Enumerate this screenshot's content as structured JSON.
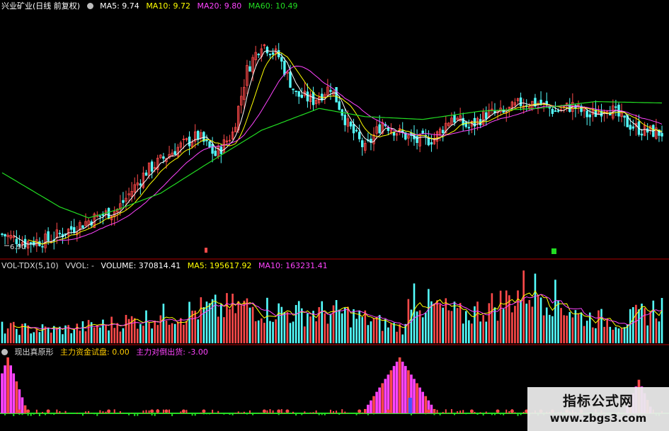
{
  "colors": {
    "up": "#ff4a4a",
    "down": "#54ffff",
    "ma5": "#ffffff",
    "ma10": "#ffff00",
    "ma20": "#ff44ff",
    "ma60": "#22dd22",
    "label": "#ffcc00",
    "sep": "#8b0000"
  },
  "price_panel": {
    "title": "兴业矿业(日线 前复权)",
    "icon": "circle-icon",
    "ma5_label": "MA5: 9.74",
    "ma10_label": "MA10: 9.72",
    "ma20_label": "MA20: 9.80",
    "ma60_label": "MA60: 10.49",
    "low_marker": "6.90"
  },
  "volume_panel": {
    "title": "VOL-TDX(5,10)",
    "vvol": "VVOL: -",
    "volume": "VOLUME: 370814.41",
    "ma5": "MA5: 195617.92",
    "ma10": "MA10: 163231.41"
  },
  "indicator_panel": {
    "title": "现出真原形",
    "icon": "circle-icon",
    "trial": "主力资金试盘: 0.00",
    "dump": "主力对倒出货: -3.00",
    "marker_text": "S"
  },
  "watermark": {
    "title": "指标公式网",
    "url": "www.zbgs3.com"
  },
  "chart_data": [
    {
      "type": "candlestick",
      "title": "兴业矿业(日线 前复权)",
      "ylim": [
        6.5,
        15.5
      ],
      "close_anchors": [
        [
          0,
          7.3
        ],
        [
          8,
          7.0
        ],
        [
          16,
          7.1
        ],
        [
          24,
          7.5
        ],
        [
          32,
          7.9
        ],
        [
          40,
          8.2
        ],
        [
          50,
          9.6
        ],
        [
          60,
          10.4
        ],
        [
          68,
          10.9
        ],
        [
          74,
          10.2
        ],
        [
          80,
          11.0
        ],
        [
          85,
          13.3
        ],
        [
          90,
          14.3
        ],
        [
          96,
          13.8
        ],
        [
          102,
          12.4
        ],
        [
          108,
          12.2
        ],
        [
          114,
          12.7
        ],
        [
          120,
          11.3
        ],
        [
          126,
          10.4
        ],
        [
          132,
          11.4
        ],
        [
          138,
          11.0
        ],
        [
          144,
          10.7
        ],
        [
          150,
          10.8
        ],
        [
          156,
          11.6
        ],
        [
          162,
          11.2
        ],
        [
          168,
          11.7
        ],
        [
          174,
          11.7
        ],
        [
          180,
          12.1
        ],
        [
          186,
          12.1
        ],
        [
          192,
          11.8
        ],
        [
          198,
          12.0
        ],
        [
          204,
          11.6
        ],
        [
          210,
          12.0
        ],
        [
          216,
          11.4
        ],
        [
          222,
          11.1
        ],
        [
          229,
          11.0
        ]
      ],
      "ma60_anchors": [
        [
          0,
          9.55
        ],
        [
          20,
          8.3
        ],
        [
          30,
          7.9
        ],
        [
          40,
          8.2
        ],
        [
          55,
          8.8
        ],
        [
          70,
          9.8
        ],
        [
          90,
          11.1
        ],
        [
          110,
          11.9
        ],
        [
          126,
          11.6
        ],
        [
          146,
          11.5
        ],
        [
          166,
          11.8
        ],
        [
          186,
          11.9
        ],
        [
          206,
          12.15
        ],
        [
          229,
          12.1
        ]
      ],
      "low_label_value": 6.9
    },
    {
      "type": "bar",
      "title": "VOL-TDX(5,10)",
      "volume_anchors": [
        [
          0,
          0.5
        ],
        [
          20,
          0.45
        ],
        [
          35,
          0.6
        ],
        [
          55,
          0.9
        ],
        [
          70,
          1.1
        ],
        [
          86,
          1.2
        ],
        [
          100,
          1.0
        ],
        [
          118,
          1.0
        ],
        [
          136,
          0.55
        ],
        [
          140,
          0.5
        ],
        [
          142,
          1.9
        ],
        [
          146,
          1.3
        ],
        [
          160,
          0.9
        ],
        [
          175,
          1.4
        ],
        [
          182,
          1.8
        ],
        [
          190,
          1.6
        ],
        [
          200,
          0.9
        ],
        [
          215,
          0.7
        ],
        [
          229,
          1.2
        ]
      ],
      "ylim": [
        0,
        2.4
      ]
    },
    {
      "type": "bar",
      "title": "现出真原形",
      "spike_groups": [
        {
          "center": 2,
          "width": 6,
          "peak": 1.0
        },
        {
          "center": 138,
          "width": 12,
          "peak": 1.0
        },
        {
          "center": 221,
          "width": 4,
          "peak": 0.6
        }
      ],
      "s_markers": [
        6,
        9,
        16,
        37,
        52,
        54,
        57,
        63,
        70,
        91,
        96,
        99,
        124,
        134,
        148,
        163,
        172,
        177,
        182,
        187,
        191,
        196,
        201
      ]
    }
  ]
}
